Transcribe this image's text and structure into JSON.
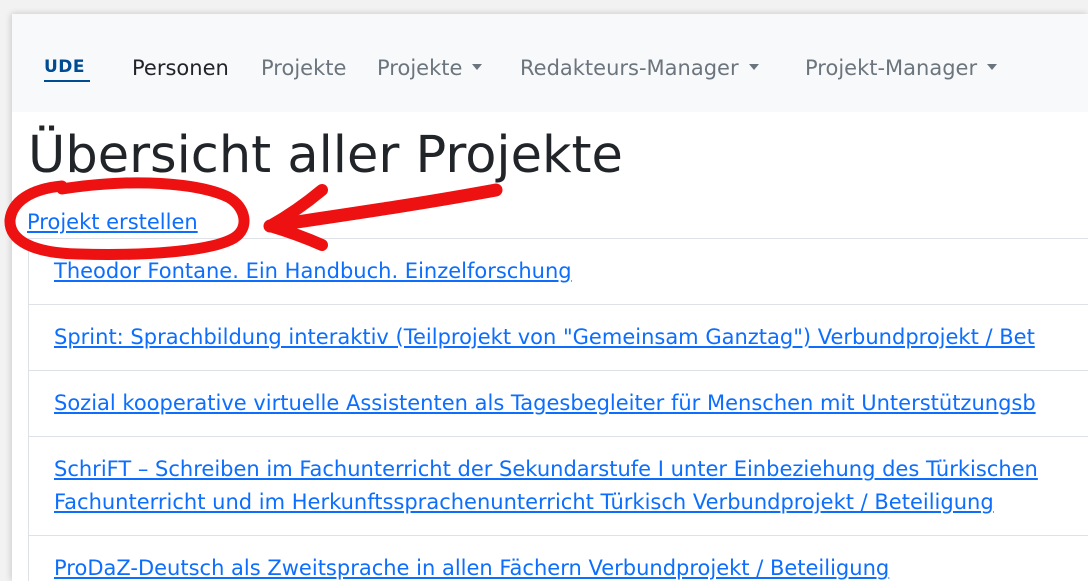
{
  "navbar": {
    "brand": "UDE",
    "links": [
      {
        "label": "Personen",
        "active": true,
        "dropdown": false
      },
      {
        "label": "Projekte",
        "active": false,
        "dropdown": false
      },
      {
        "label": "Projekte",
        "active": false,
        "dropdown": true
      },
      {
        "label": "Redakteurs-Manager",
        "active": false,
        "dropdown": true
      },
      {
        "label": "Projekt-Manager",
        "active": false,
        "dropdown": true
      }
    ]
  },
  "main": {
    "title": "Übersicht aller Projekte",
    "create_link": "Projekt erstellen",
    "projects": [
      {
        "line1": "Theodor Fontane. Ein Handbuch. Einzelforschung"
      },
      {
        "line1": "Sprint: Sprachbildung interaktiv (Teilprojekt von \"Gemeinsam Ganztag\") Verbundprojekt / Bet"
      },
      {
        "line1": "Sozial kooperative virtuelle Assistenten als Tagesbegleiter für Menschen mit Unterstützungsb"
      },
      {
        "line1": "SchriFT – Schreiben im Fachunterricht der Sekundarstufe I unter Einbeziehung des Türkischen",
        "line2": "Fachunterricht und im Herkunftssprachenunterricht Türkisch Verbundprojekt / Beteiligung"
      },
      {
        "line1": "ProDaZ-Deutsch als Zweitsprache in allen Fächern Verbundprojekt / Beteiligung"
      }
    ]
  },
  "colors": {
    "link": "#0d6efd",
    "navbar_bg": "#f8f9fa",
    "brand": "#004c93",
    "annotation": "#ee1111"
  }
}
